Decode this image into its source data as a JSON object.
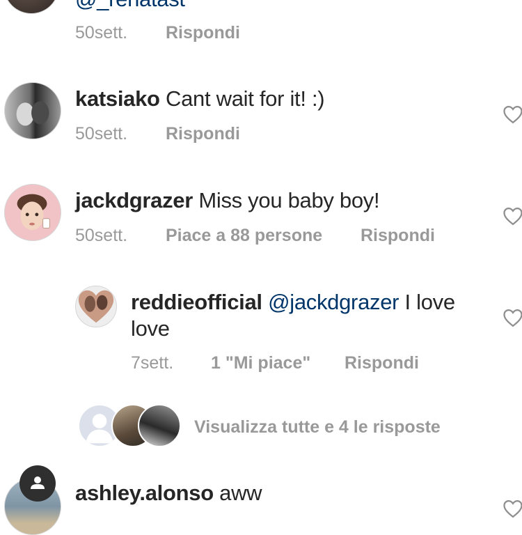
{
  "comments": [
    {
      "username": "@_renatast",
      "time": "50sett.",
      "reply": "Rispondi"
    },
    {
      "username": "katsiako",
      "text": "Cant wait for it! :)",
      "time": "50sett.",
      "reply": "Rispondi"
    },
    {
      "username": "jackdgrazer",
      "text": "Miss you baby boy!",
      "time": "50sett.",
      "likes": "Piace a 88 persone",
      "reply": "Rispondi",
      "replies": [
        {
          "username": "reddieofficial",
          "mention": "@jackdgrazer",
          "text_line1": "I love",
          "text_line2": "love",
          "time": "7sett.",
          "likes": "1 \"Mi piace\"",
          "reply": "Rispondi"
        }
      ],
      "view_replies": "Visualizza tutte e 4 le risposte"
    },
    {
      "username": "ashley.alonso",
      "text": "aww"
    }
  ],
  "colors": {
    "username": "#262626",
    "mention": "#003569",
    "meta": "#999999",
    "heart": "#8e8e8e"
  }
}
